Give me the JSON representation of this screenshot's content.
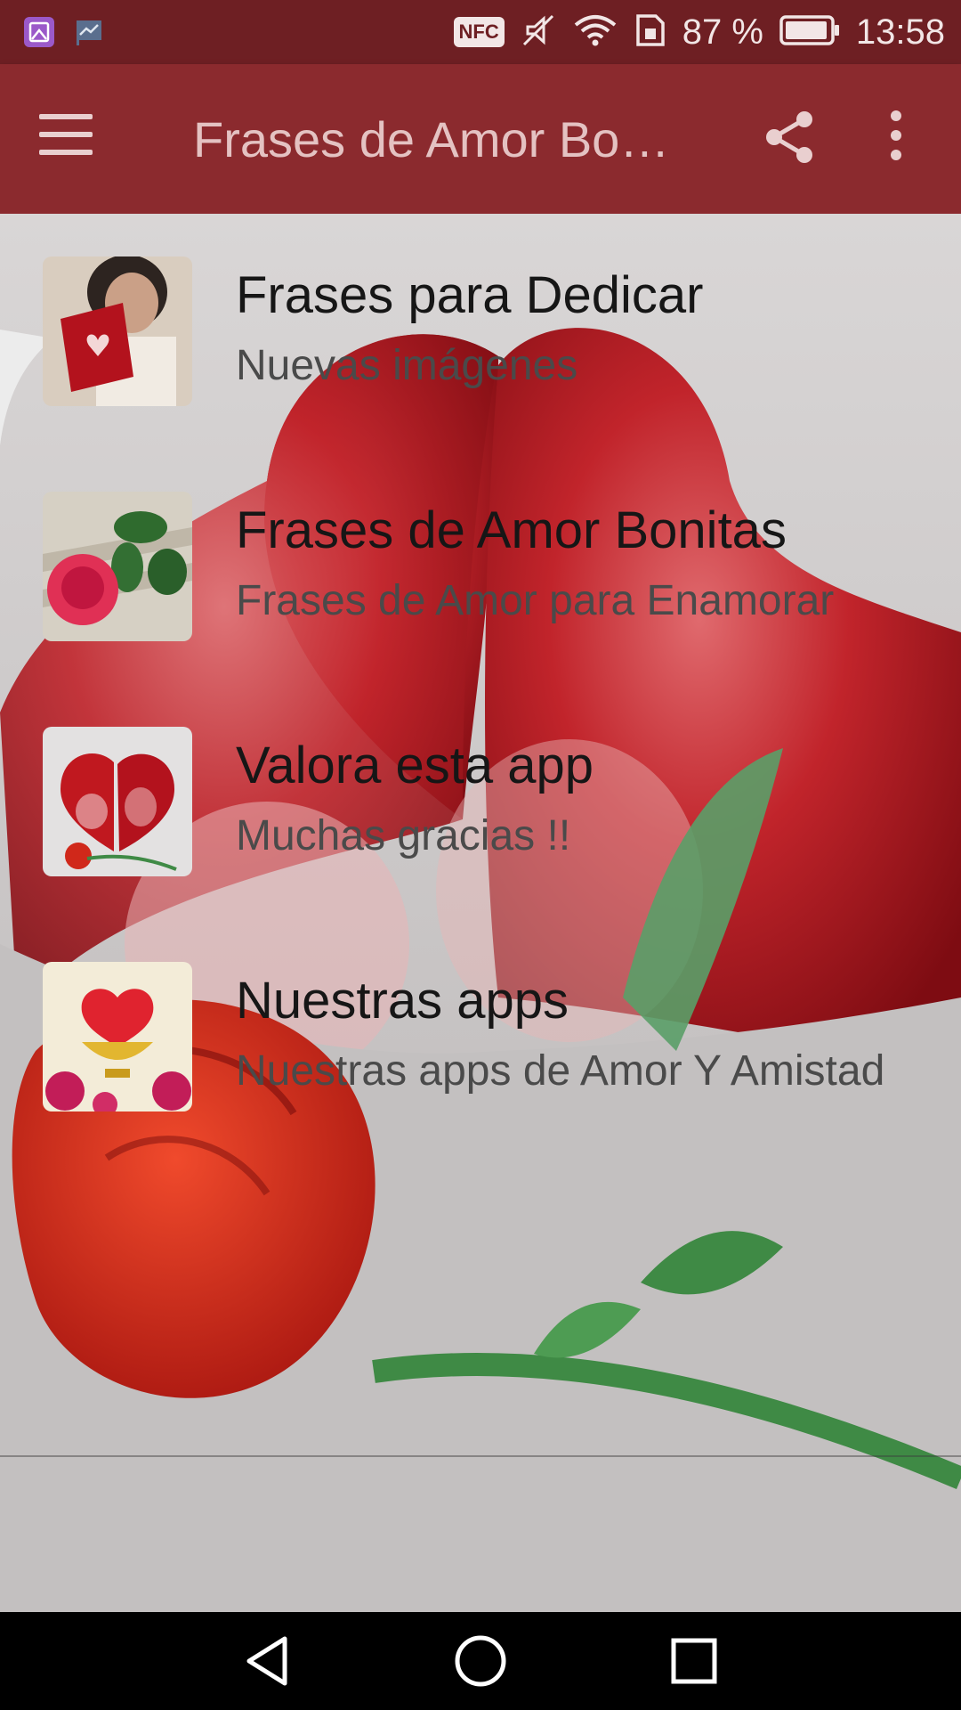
{
  "status_bar": {
    "nfc": "NFC",
    "battery": "87 %",
    "time": "13:58"
  },
  "app_bar": {
    "title": "Frases de Amor Bonitas"
  },
  "list": [
    {
      "title": "Frases para Dedicar",
      "subtitle": "Nuevas imágenes"
    },
    {
      "title": "Frases de Amor Bonitas",
      "subtitle": "Frases de Amor para Enamorar"
    },
    {
      "title": "Valora esta app",
      "subtitle": "Muchas gracias !!"
    },
    {
      "title": "Nuestras apps",
      "subtitle": "Nuestras apps de Amor Y Amistad"
    }
  ],
  "colors": {
    "status_bar": "#6e1f23",
    "app_bar": "#8b2a2e",
    "heart": "#b3121d",
    "rose": "#d0281a",
    "leaf": "#3f8a45"
  },
  "icons": [
    "gallery-icon",
    "chart-flag-icon",
    "nfc-icon",
    "mute-icon",
    "wifi-icon",
    "sim-icon",
    "battery-icon",
    "menu-icon",
    "share-icon",
    "more-vert-icon",
    "back-icon",
    "home-icon",
    "recents-icon"
  ]
}
